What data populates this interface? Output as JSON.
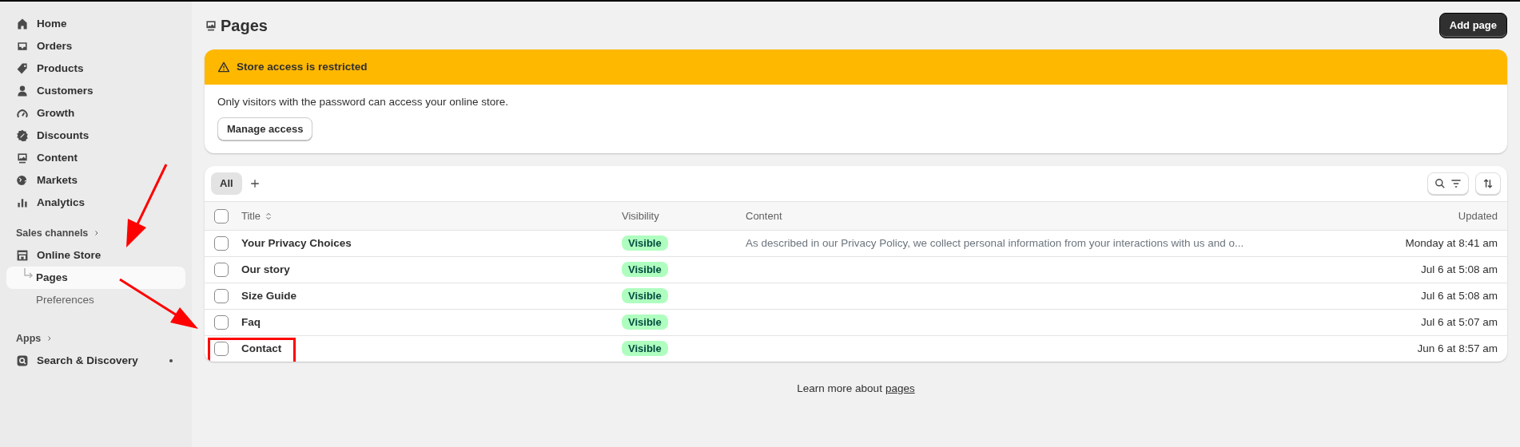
{
  "sidebar": {
    "items": [
      {
        "label": "Home",
        "selected": false
      },
      {
        "label": "Orders",
        "selected": false
      },
      {
        "label": "Products",
        "selected": false
      },
      {
        "label": "Customers",
        "selected": false
      },
      {
        "label": "Growth",
        "selected": false
      },
      {
        "label": "Discounts",
        "selected": false
      },
      {
        "label": "Content",
        "selected": false
      },
      {
        "label": "Markets",
        "selected": false
      },
      {
        "label": "Analytics",
        "selected": false
      }
    ],
    "sales_channels": {
      "label": "Sales channels",
      "items": [
        {
          "label": "Online Store",
          "selected": false,
          "children": [
            {
              "label": "Pages",
              "selected": true
            },
            {
              "label": "Preferences",
              "selected": false
            }
          ]
        }
      ]
    },
    "apps": {
      "label": "Apps",
      "items": [
        {
          "label": "Search & Discovery",
          "selected": false,
          "dot": true
        }
      ]
    }
  },
  "page": {
    "title": "Pages",
    "primary_action": "Add page"
  },
  "banner": {
    "title": "Store access is restricted",
    "message": "Only visitors with the password can access your online store.",
    "action": "Manage access"
  },
  "tabs": [
    {
      "label": "All",
      "selected": true
    }
  ],
  "table": {
    "select_all_checked": false,
    "columns": [
      "Title",
      "Visibility",
      "Content",
      "Updated"
    ],
    "rows": [
      {
        "title": "Your Privacy Choices",
        "visibility": "Visible",
        "content": "As described in our Privacy Policy, we collect personal information from your interactions with us and o...",
        "updated": "Monday at 8:41 am",
        "checked": false,
        "highlighted": false
      },
      {
        "title": "Our story",
        "visibility": "Visible",
        "updated": "Jul 6 at 5:08 am",
        "checked": false,
        "highlighted": false
      },
      {
        "title": "Size Guide",
        "visibility": "Visible",
        "updated": "Jul 6 at 5:08 am",
        "checked": false,
        "highlighted": false
      },
      {
        "title": "Faq",
        "visibility": "Visible",
        "updated": "Jul 6 at 5:07 am",
        "checked": false,
        "highlighted": false
      },
      {
        "title": "Contact",
        "visibility": "Visible",
        "updated": "Jun 6 at 8:57 am",
        "checked": false,
        "highlighted": true
      }
    ]
  },
  "footer": {
    "text": "Learn more about",
    "link": "pages"
  }
}
